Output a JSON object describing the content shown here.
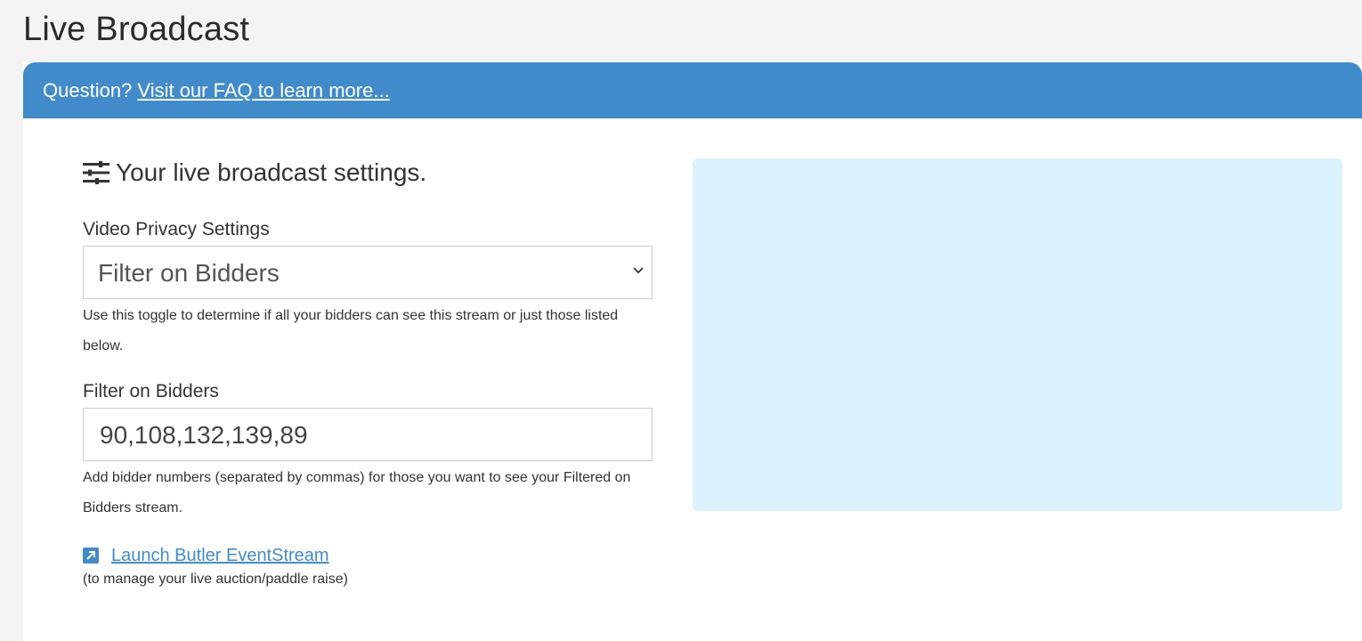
{
  "page": {
    "title": "Live Broadcast"
  },
  "banner": {
    "prefix": "Question?",
    "link_text": "Visit our FAQ to learn more..."
  },
  "settings": {
    "heading": "Your live broadcast settings.",
    "privacy": {
      "label": "Video Privacy Settings",
      "selected": "Filter on Bidders",
      "help": "Use this toggle to determine if all your bidders can see this stream or just those listed below."
    },
    "filter": {
      "label": "Filter on Bidders",
      "value": "90,108,132,139,89",
      "help": "Add bidder numbers (separated by commas) for those you want to see your Filtered on Bidders stream."
    },
    "launch": {
      "link_text": "Launch Butler EventStream",
      "note": "(to manage your live auction/paddle raise)"
    }
  },
  "icons": {
    "settings": "sliders-icon",
    "select": "chevron-down-icon",
    "launch": "external-link-icon"
  },
  "colors": {
    "accent": "#428bca",
    "preview_bg": "#daf2fc",
    "page_bg": "#f4f4f4"
  }
}
